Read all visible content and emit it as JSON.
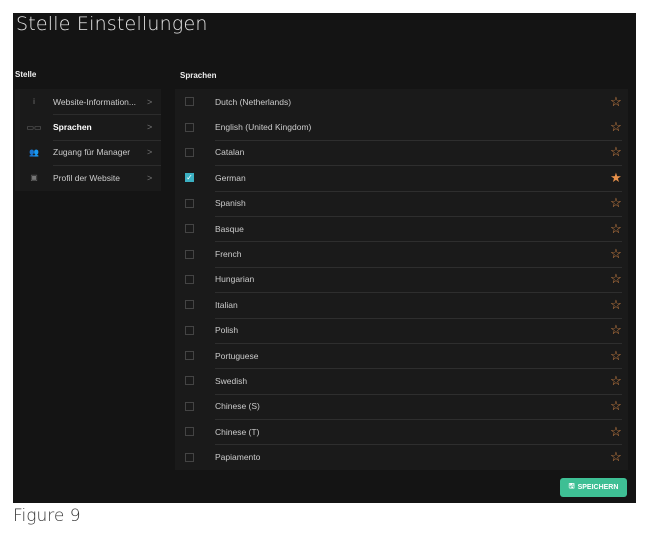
{
  "title": "Stelle Einstellungen",
  "sidebar": {
    "heading": "Stelle",
    "items": [
      {
        "label": "Website-Information...",
        "icon": "info-icon",
        "glyph": "i"
      },
      {
        "label": "Sprachen",
        "icon": "language-icon",
        "glyph": "▭▭"
      },
      {
        "label": "Zugang für Manager",
        "icon": "users-icon",
        "glyph": "👥"
      },
      {
        "label": "Profil der Website",
        "icon": "profile-icon",
        "glyph": "▣"
      }
    ]
  },
  "languages": {
    "heading": "Sprachen",
    "items": [
      {
        "name": "Dutch (Netherlands)",
        "checked": false,
        "starred": false
      },
      {
        "name": "English (United Kingdom)",
        "checked": false,
        "starred": false
      },
      {
        "name": "Catalan",
        "checked": false,
        "starred": false
      },
      {
        "name": "German",
        "checked": true,
        "starred": true
      },
      {
        "name": "Spanish",
        "checked": false,
        "starred": false
      },
      {
        "name": "Basque",
        "checked": false,
        "starred": false
      },
      {
        "name": "French",
        "checked": false,
        "starred": false
      },
      {
        "name": "Hungarian",
        "checked": false,
        "starred": false
      },
      {
        "name": "Italian",
        "checked": false,
        "starred": false
      },
      {
        "name": "Polish",
        "checked": false,
        "starred": false
      },
      {
        "name": "Portuguese",
        "checked": false,
        "starred": false
      },
      {
        "name": "Swedish",
        "checked": false,
        "starred": false
      },
      {
        "name": "Chinese (S)",
        "checked": false,
        "starred": false
      },
      {
        "name": "Chinese (T)",
        "checked": false,
        "starred": false
      },
      {
        "name": "Papiamento",
        "checked": false,
        "starred": false
      }
    ]
  },
  "save_label": "SPEICHERN",
  "caption": "Figure 9",
  "colors": {
    "accent": "#3ebf94",
    "star": "#e8914a",
    "checkbox": "#3bb0c2"
  }
}
